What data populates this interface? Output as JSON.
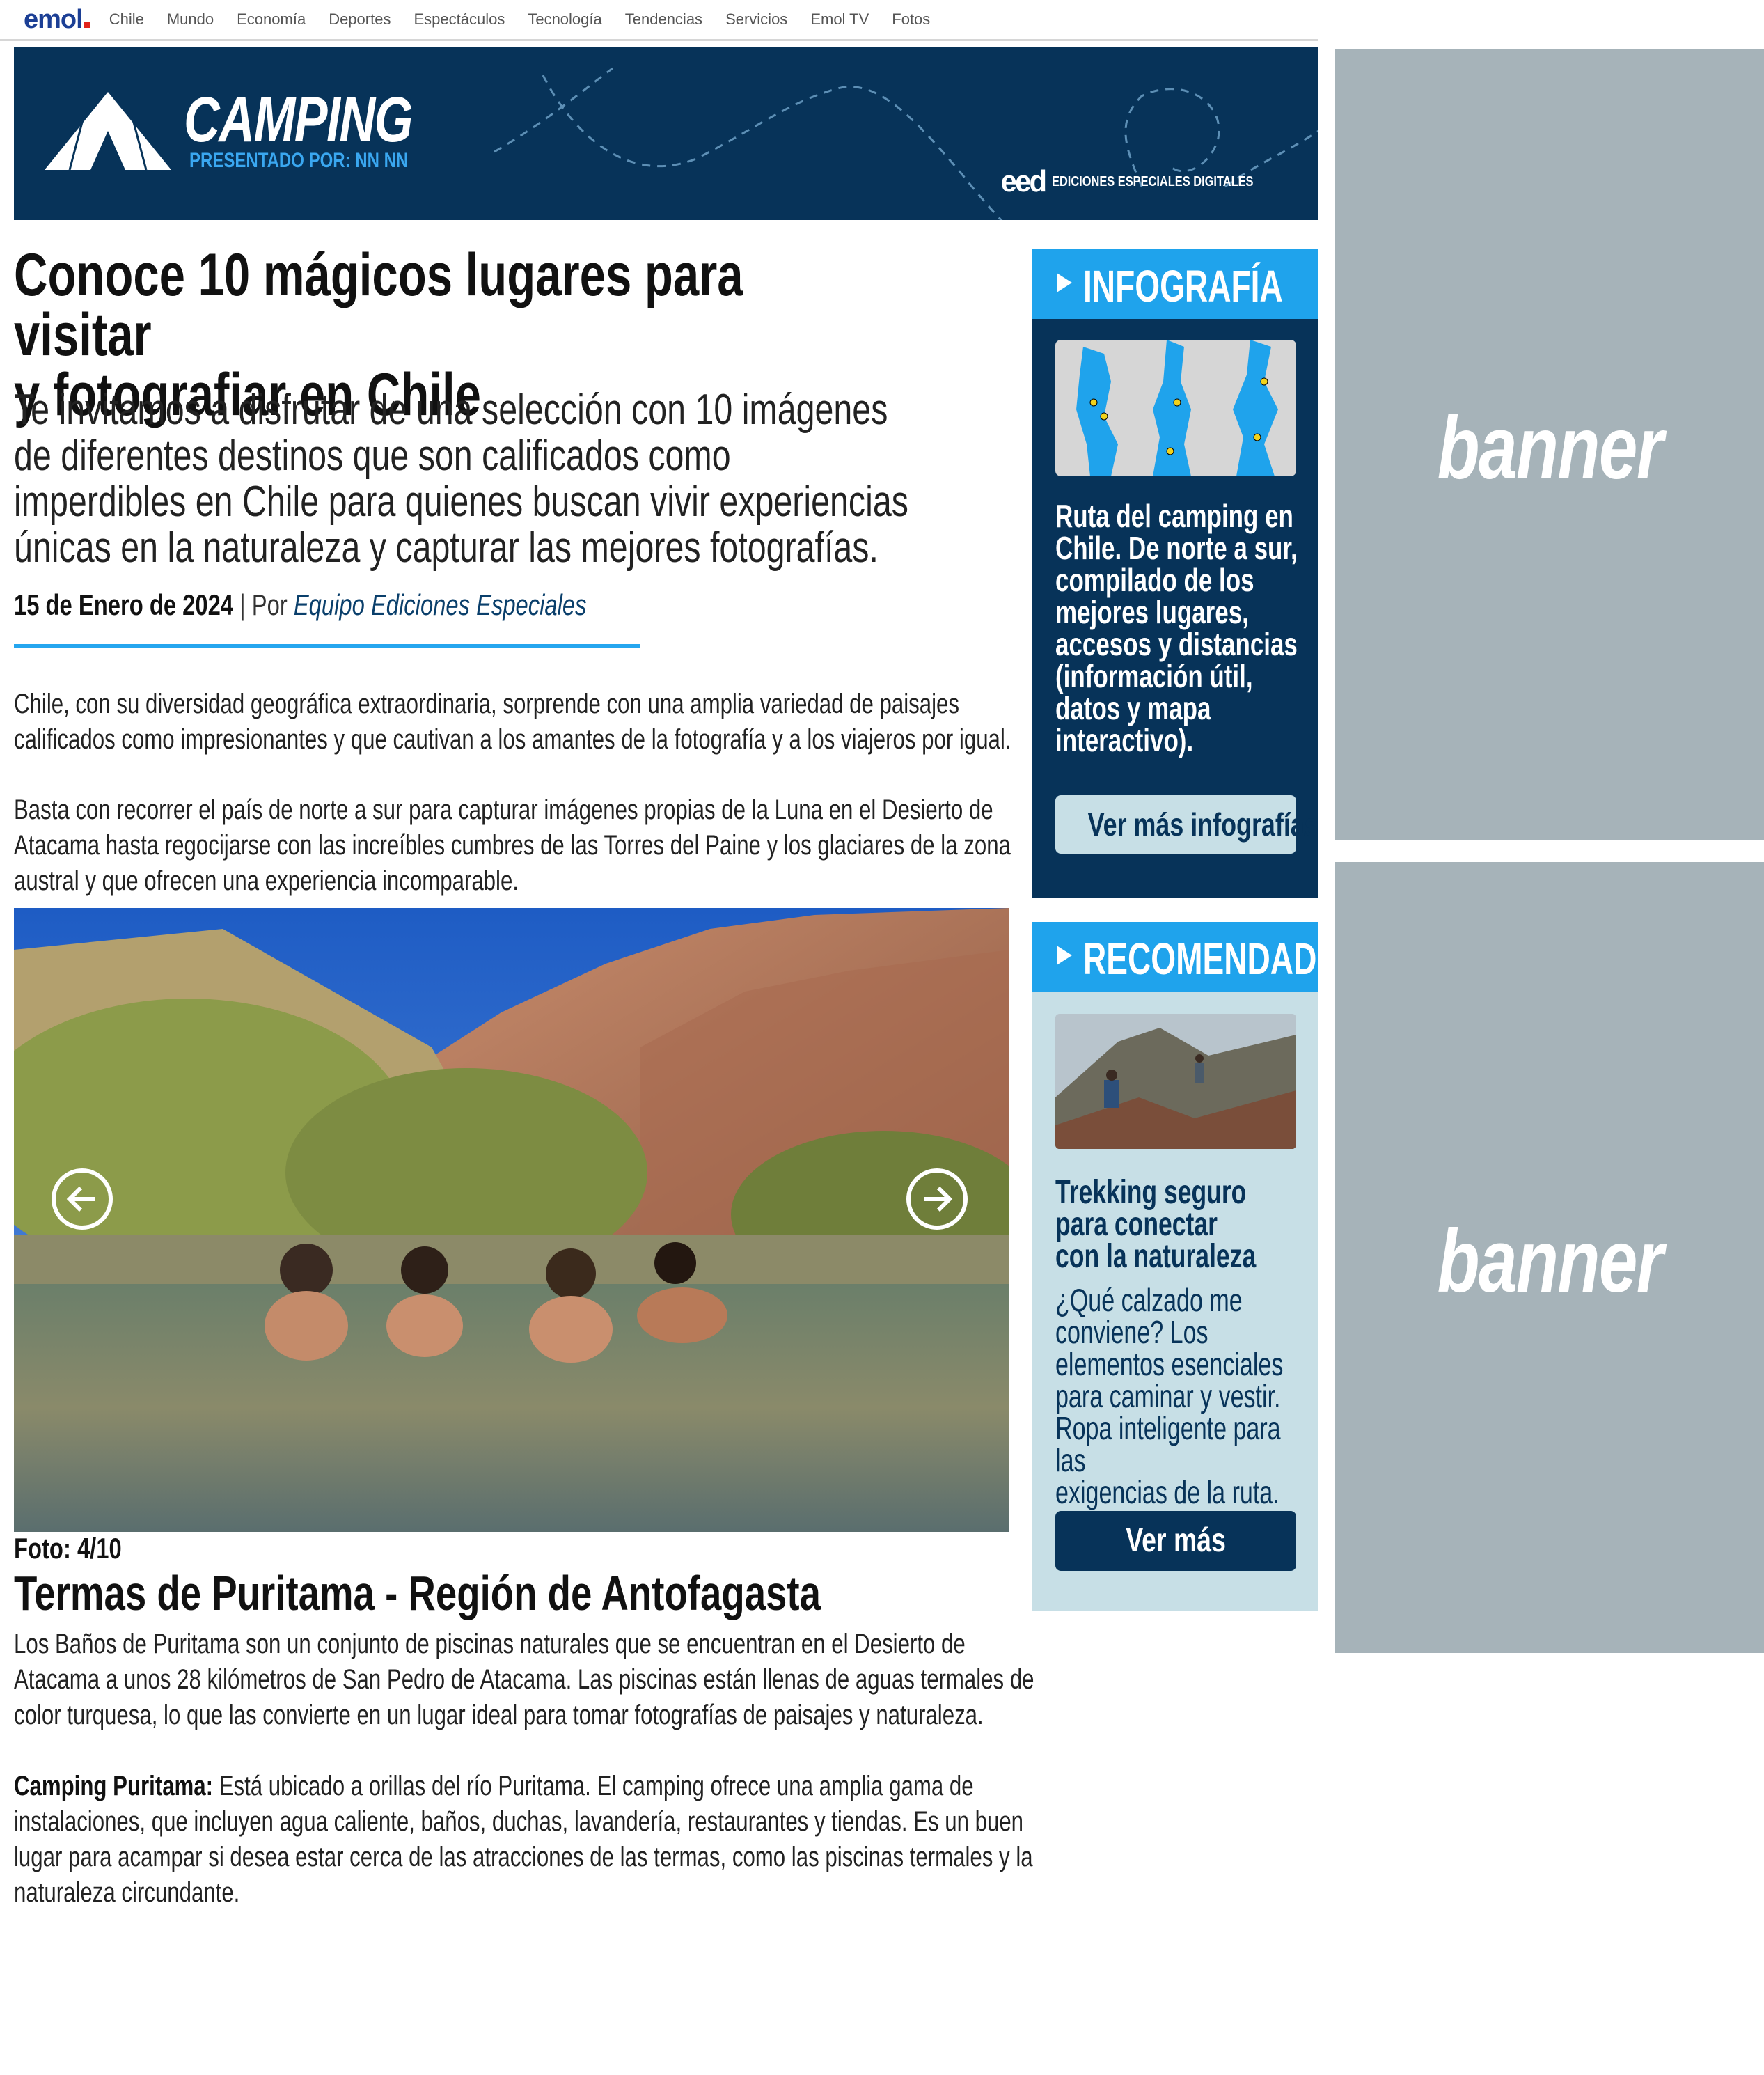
{
  "topnav": {
    "logo": "emol",
    "links": [
      "Chile",
      "Mundo",
      "Economía",
      "Deportes",
      "Espectáculos",
      "Tecnología",
      "Tendencias",
      "Servicios",
      "Emol TV",
      "Fotos"
    ]
  },
  "hero": {
    "title": "CAMPING",
    "presented_by": "PRESENTADO POR: NN NN",
    "eed_logo": "eed",
    "eed_text": "EDICIONES ESPECIALES DIGITALES"
  },
  "article": {
    "headline_line1": "Conoce 10 mágicos lugares para visitar",
    "headline_line2": "y fotografiar en Chile",
    "subhead_lines": [
      "Te invitamos a disfrutar de una selección con 10 imágenes",
      "de diferentes destinos que son calificados como",
      "imperdibles en Chile para quienes buscan vivir experiencias",
      "únicas en la naturaleza y capturar las mejores fotografías."
    ],
    "date": "15 de Enero de 2024",
    "separator": " | Por ",
    "author": "Equipo Ediciones Especiales",
    "p1_lines": [
      "Chile, con su diversidad geográfica extraordinaria, sorprende con una amplia variedad de paisajes",
      "calificados como impresionantes y que cautivan a los amantes de la fotografía y a los viajeros por igual."
    ],
    "p2_lines": [
      "Basta con recorrer el país de norte a sur para capturar imágenes propias de la Luna en el Desierto de",
      "Atacama hasta regocijarse con las increíbles cumbres de las Torres del Paine y los glaciares de la zona",
      "austral y que ofrecen una experiencia incomparable."
    ],
    "photo_counter": "Foto: 4/10",
    "caption_title": "Termas de Puritama - Región de Antofagasta",
    "p3_lines": [
      "Los Baños de Puritama son un conjunto de piscinas naturales que se encuentran en el Desierto de",
      "Atacama a unos 28 kilómetros de San Pedro de Atacama. Las piscinas están llenas de aguas termales de",
      "color turquesa, lo que las convierte en un lugar ideal para tomar fotografías de paisajes y naturaleza."
    ],
    "p4_bold": "Camping Puritama:",
    "p4_lines": [
      " Está ubicado a orillas del río Puritama. El camping ofrece una amplia gama de",
      "instalaciones, que incluyen agua caliente, baños, duchas, lavandería, restaurantes y tiendas. Es un buen",
      "lugar para acampar si desea estar cerca de las atracciones de las termas, como las piscinas termales y la",
      "naturaleza circundante."
    ]
  },
  "sidebar": {
    "infografia": {
      "label": "INFOGRAFÍA",
      "text_lines": [
        "Ruta del camping en",
        "Chile. De norte a sur,",
        "compilado de los",
        "mejores lugares,",
        "accesos y distancias",
        "(información útil,",
        "datos y mapa",
        "interactivo)."
      ],
      "button": "Ver más infografías"
    },
    "recomendado": {
      "label": "RECOMENDADO",
      "title_lines": [
        "Trekking seguro",
        "para conectar",
        "con la naturaleza"
      ],
      "desc_lines": [
        "¿Qué calzado me",
        "conviene? Los",
        "elementos esenciales",
        "para caminar y vestir.",
        "Ropa inteligente para las",
        "exigencias de la ruta."
      ],
      "button": "Ver más"
    }
  },
  "banners": [
    "banner",
    "banner"
  ],
  "colors": {
    "navy": "#073359",
    "accent_blue": "#1fa3ec",
    "light_blue": "#c7dfe6",
    "banner_gray": "#a6b3b9"
  }
}
